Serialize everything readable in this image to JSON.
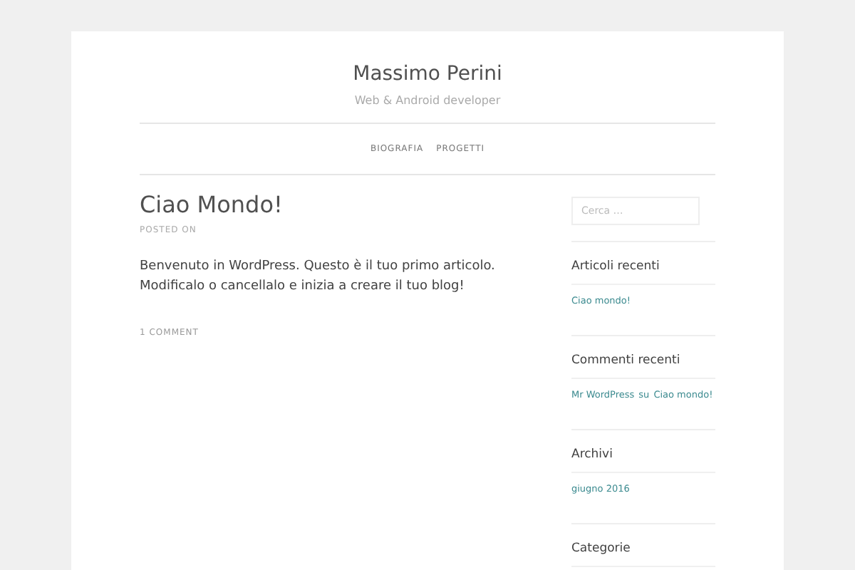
{
  "site": {
    "title": "Massimo Perini",
    "tagline": "Web & Android developer"
  },
  "nav": [
    {
      "label": "BIOGRAFIA"
    },
    {
      "label": "PROGETTI"
    }
  ],
  "post": {
    "title": "Ciao Mondo!",
    "meta": "POSTED ON",
    "body": "Benvenuto in WordPress. Questo è il tuo primo articolo. Modificalo o cancellalo e inizia a creare il tuo blog!",
    "comments": "1 COMMENT"
  },
  "sidebar": [
    {
      "kind": "search",
      "placeholder": "Cerca …"
    },
    {
      "kind": "links",
      "heading": "Articoli recenti",
      "items": [
        {
          "text": "Ciao mondo!"
        }
      ]
    },
    {
      "kind": "comments",
      "heading": "Commenti recenti",
      "items": [
        {
          "author": "Mr WordPress",
          "connector": "su",
          "post": "Ciao mondo!"
        }
      ]
    },
    {
      "kind": "links",
      "heading": "Archivi",
      "items": [
        {
          "text": "giugno 2016"
        }
      ]
    },
    {
      "kind": "heading",
      "heading": "Categorie"
    }
  ]
}
